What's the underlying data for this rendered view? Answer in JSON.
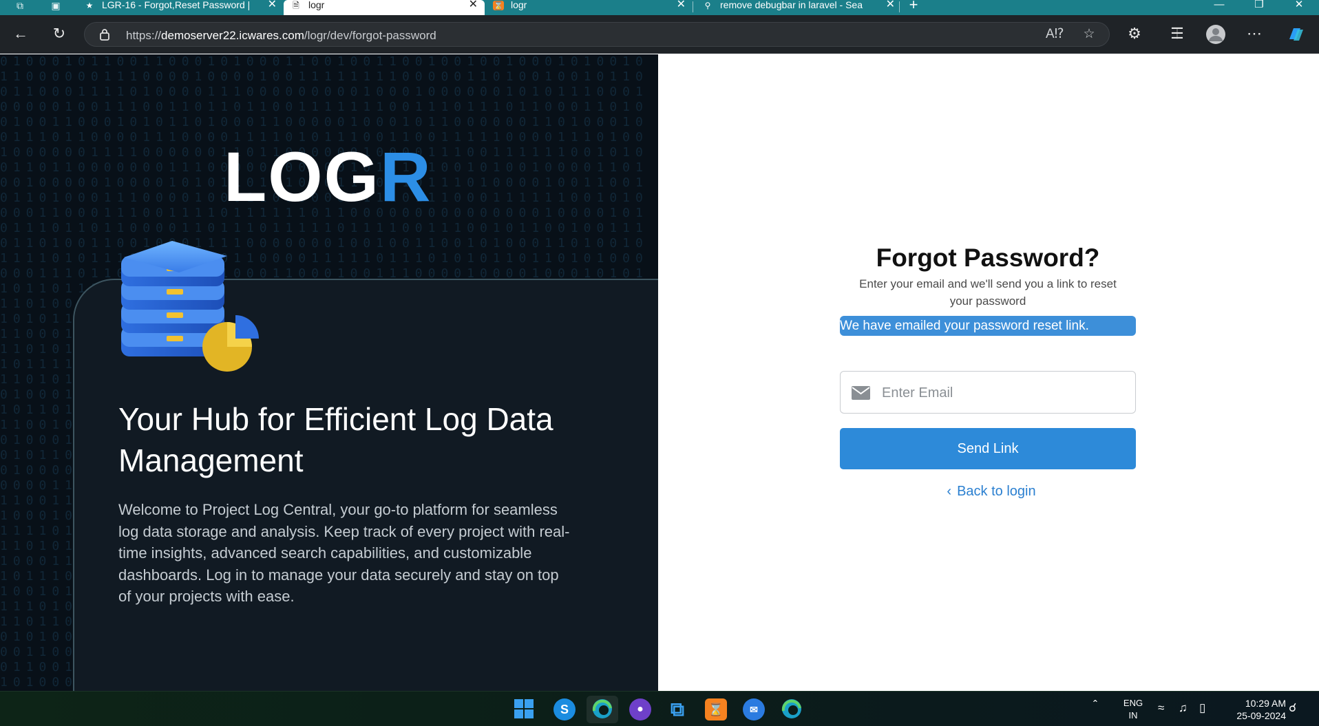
{
  "browser": {
    "tabs": [
      {
        "title": "LGR-16 - Forgot,Reset Password |",
        "favicon": "jira-icon"
      },
      {
        "title": "logr",
        "favicon": "page-icon"
      },
      {
        "title": "logr",
        "favicon": "xampp-icon"
      },
      {
        "title": "remove debugbar in laravel - Sea",
        "favicon": "search-icon"
      }
    ],
    "url_prefix": "https://",
    "url_host": "demoserver22.icwares.com",
    "url_path": "/logr/dev/forgot-password"
  },
  "left": {
    "logo_main": "LOG",
    "logo_accent": "R",
    "hub_title": "Your Hub for Efficient Log Data Management",
    "hub_desc": "Welcome to Project Log Central, your go-to platform for seamless log data storage and analysis. Keep track of every project with real-time insights, advanced search capabilities, and customizable dashboards. Log in to manage your data securely and stay on top of your projects with ease."
  },
  "form": {
    "title": "Forgot Password?",
    "subtitle": "Enter your email and we'll send you a link to reset your password",
    "alert": "We have emailed your password reset link.",
    "email_placeholder": "Enter Email",
    "email_value": "",
    "send_label": "Send Link",
    "back_label": "Back to login"
  },
  "taskbar": {
    "lang_line1": "ENG",
    "lang_line2": "IN",
    "time": "10:29 AM",
    "date": "25-09-2024"
  },
  "colors": {
    "accent": "#2d8ad9",
    "tabstrip": "#1b7f8a",
    "left_bg": "#081018"
  }
}
